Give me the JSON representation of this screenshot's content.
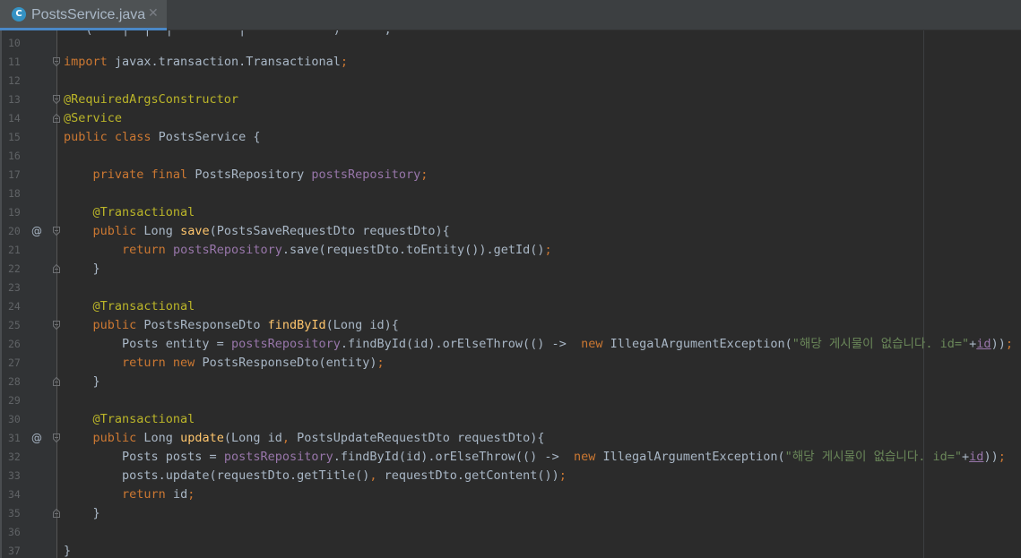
{
  "tab": {
    "icon_letter": "C",
    "title": "PostsService.java",
    "close": "✕"
  },
  "editor": {
    "top_partial": "   (    |  |  |         |            )      ;",
    "lines": [
      {
        "num": "10",
        "parts": []
      },
      {
        "num": "11",
        "fold": "start",
        "parts": [
          {
            "t": "import",
            "c": "k"
          },
          {
            "t": " javax.transaction.Transactional",
            "c": "p"
          },
          {
            "t": ";",
            "c": "k"
          }
        ]
      },
      {
        "num": "12",
        "parts": []
      },
      {
        "num": "13",
        "fold": "start",
        "parts": [
          {
            "t": "@RequiredArgsConstructor",
            "c": "a"
          }
        ]
      },
      {
        "num": "14",
        "fold": "end",
        "parts": [
          {
            "t": "@Service",
            "c": "a"
          }
        ]
      },
      {
        "num": "15",
        "parts": [
          {
            "t": "public class",
            "c": "k"
          },
          {
            "t": " PostsService {",
            "c": "p"
          }
        ]
      },
      {
        "num": "16",
        "parts": []
      },
      {
        "num": "17",
        "parts": [
          {
            "t": "    ",
            "c": "p"
          },
          {
            "t": "private final",
            "c": "k"
          },
          {
            "t": " PostsRepository ",
            "c": "p"
          },
          {
            "t": "postsRepository",
            "c": "f"
          },
          {
            "t": ";",
            "c": "k"
          }
        ]
      },
      {
        "num": "18",
        "parts": []
      },
      {
        "num": "19",
        "parts": [
          {
            "t": "    ",
            "c": "p"
          },
          {
            "t": "@Transactional",
            "c": "a"
          }
        ]
      },
      {
        "num": "20",
        "at": true,
        "fold": "start",
        "parts": [
          {
            "t": "    ",
            "c": "p"
          },
          {
            "t": "public",
            "c": "k"
          },
          {
            "t": " Long ",
            "c": "p"
          },
          {
            "t": "save",
            "c": "m"
          },
          {
            "t": "(PostsSaveRequestDto requestDto){",
            "c": "p"
          }
        ]
      },
      {
        "num": "21",
        "parts": [
          {
            "t": "        ",
            "c": "p"
          },
          {
            "t": "return",
            "c": "k"
          },
          {
            "t": " ",
            "c": "p"
          },
          {
            "t": "postsRepository",
            "c": "f"
          },
          {
            "t": ".save(requestDto.toEntity()).getId()",
            "c": "p"
          },
          {
            "t": ";",
            "c": "k"
          }
        ]
      },
      {
        "num": "22",
        "fold": "end",
        "parts": [
          {
            "t": "    }",
            "c": "p"
          }
        ]
      },
      {
        "num": "23",
        "parts": []
      },
      {
        "num": "24",
        "parts": [
          {
            "t": "    ",
            "c": "p"
          },
          {
            "t": "@Transactional",
            "c": "a"
          }
        ]
      },
      {
        "num": "25",
        "fold": "start",
        "parts": [
          {
            "t": "    ",
            "c": "p"
          },
          {
            "t": "public",
            "c": "k"
          },
          {
            "t": " PostsResponseDto ",
            "c": "p"
          },
          {
            "t": "findById",
            "c": "m"
          },
          {
            "t": "(Long id){",
            "c": "p"
          }
        ]
      },
      {
        "num": "26",
        "parts": [
          {
            "t": "        Posts entity = ",
            "c": "p"
          },
          {
            "t": "postsRepository",
            "c": "f"
          },
          {
            "t": ".findById(id).orElseThrow(() ->  ",
            "c": "p"
          },
          {
            "t": "new",
            "c": "k"
          },
          {
            "t": " IllegalArgumentException(",
            "c": "p"
          },
          {
            "t": "\"해당 게시물이 없습니다. id=\"",
            "c": "s"
          },
          {
            "t": "+",
            "c": "p"
          },
          {
            "t": "id",
            "c": "u"
          },
          {
            "t": "))",
            "c": "p"
          },
          {
            "t": ";",
            "c": "k"
          }
        ]
      },
      {
        "num": "27",
        "parts": [
          {
            "t": "        ",
            "c": "p"
          },
          {
            "t": "return new",
            "c": "k"
          },
          {
            "t": " PostsResponseDto(entity)",
            "c": "p"
          },
          {
            "t": ";",
            "c": "k"
          }
        ]
      },
      {
        "num": "28",
        "fold": "end",
        "parts": [
          {
            "t": "    }",
            "c": "p"
          }
        ]
      },
      {
        "num": "29",
        "parts": []
      },
      {
        "num": "30",
        "parts": [
          {
            "t": "    ",
            "c": "p"
          },
          {
            "t": "@Transactional",
            "c": "a"
          }
        ]
      },
      {
        "num": "31",
        "at": true,
        "fold": "start",
        "parts": [
          {
            "t": "    ",
            "c": "p"
          },
          {
            "t": "public",
            "c": "k"
          },
          {
            "t": " Long ",
            "c": "p"
          },
          {
            "t": "update",
            "c": "m"
          },
          {
            "t": "(Long id",
            "c": "p"
          },
          {
            "t": ",",
            "c": "k"
          },
          {
            "t": " PostsUpdateRequestDto requestDto){",
            "c": "p"
          }
        ]
      },
      {
        "num": "32",
        "parts": [
          {
            "t": "        Posts posts = ",
            "c": "p"
          },
          {
            "t": "postsRepository",
            "c": "f"
          },
          {
            "t": ".findById(id).orElseThrow(() ->  ",
            "c": "p"
          },
          {
            "t": "new",
            "c": "k"
          },
          {
            "t": " IllegalArgumentException(",
            "c": "p"
          },
          {
            "t": "\"해당 게시물이 없습니다. id=\"",
            "c": "s"
          },
          {
            "t": "+",
            "c": "p"
          },
          {
            "t": "id",
            "c": "u"
          },
          {
            "t": "))",
            "c": "p"
          },
          {
            "t": ";",
            "c": "k"
          }
        ]
      },
      {
        "num": "33",
        "parts": [
          {
            "t": "        posts.update(requestDto.getTitle()",
            "c": "p"
          },
          {
            "t": ",",
            "c": "k"
          },
          {
            "t": " requestDto.getContent())",
            "c": "p"
          },
          {
            "t": ";",
            "c": "k"
          }
        ]
      },
      {
        "num": "34",
        "parts": [
          {
            "t": "        ",
            "c": "p"
          },
          {
            "t": "return",
            "c": "k"
          },
          {
            "t": " id",
            "c": "p"
          },
          {
            "t": ";",
            "c": "k"
          }
        ]
      },
      {
        "num": "35",
        "fold": "end",
        "parts": [
          {
            "t": "    }",
            "c": "p"
          }
        ]
      },
      {
        "num": "36",
        "parts": []
      },
      {
        "num": "37",
        "parts": [
          {
            "t": "}",
            "c": "p"
          }
        ]
      }
    ]
  },
  "colors": {
    "background": "#2b2b2b",
    "gutter": "#313335",
    "keyword": "#cc7832",
    "annotation": "#bbb529",
    "field": "#9876aa",
    "method": "#ffc66d",
    "string": "#6a8759",
    "plain": "#a9b7c6",
    "tab_accent": "#4a88c7"
  }
}
